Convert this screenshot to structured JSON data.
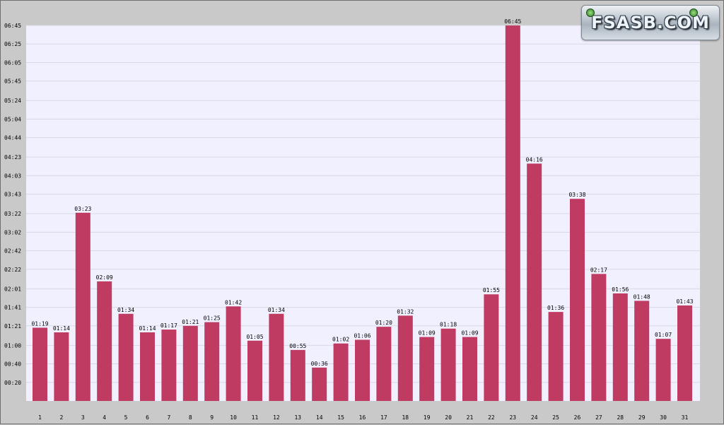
{
  "logo": {
    "text": "FSASB.COM"
  },
  "chart_data": {
    "type": "bar",
    "title": "",
    "xlabel": "",
    "ylabel": "",
    "categories": [
      "1",
      "2",
      "3",
      "4",
      "5",
      "6",
      "7",
      "8",
      "9",
      "10",
      "11",
      "12",
      "13",
      "14",
      "15",
      "16",
      "17",
      "18",
      "19",
      "20",
      "21",
      "22",
      "23",
      "24",
      "25",
      "26",
      "27",
      "28",
      "29",
      "30",
      "31"
    ],
    "values_seconds": [
      79,
      74,
      203,
      129,
      94,
      74,
      77,
      81,
      85,
      102,
      65,
      94,
      55,
      36,
      62,
      66,
      80,
      92,
      69,
      78,
      69,
      115,
      405,
      256,
      96,
      218,
      137,
      116,
      108,
      67,
      103
    ],
    "value_labels": [
      "01:19",
      "01:14",
      "03:23",
      "02:09",
      "01:34",
      "01:14",
      "01:17",
      "01:21",
      "01:25",
      "01:42",
      "01:05",
      "01:34",
      "00:55",
      "00:36",
      "01:02",
      "01:06",
      "01:20",
      "01:32",
      "01:09",
      "01:18",
      "01:09",
      "01:55",
      "06:45",
      "04:16",
      "01:36",
      "03:38",
      "02:17",
      "01:56",
      "01:48",
      "01:07",
      "01:43"
    ],
    "y_ticks": [
      "00:20",
      "00:40",
      "01:00",
      "01:21",
      "01:41",
      "02:01",
      "02:22",
      "02:42",
      "03:02",
      "03:22",
      "03:43",
      "04:03",
      "04:23",
      "04:44",
      "05:04",
      "05:24",
      "05:45",
      "06:05",
      "06:25",
      "06:45"
    ],
    "ylim_seconds": [
      0,
      405
    ],
    "grid": true,
    "colors": {
      "bar": "#c03b62",
      "plot_bg": "#f0f0fe",
      "grid": "#d9d9e6",
      "outer_bg": "#c9c9c9",
      "text": "#000000"
    }
  }
}
